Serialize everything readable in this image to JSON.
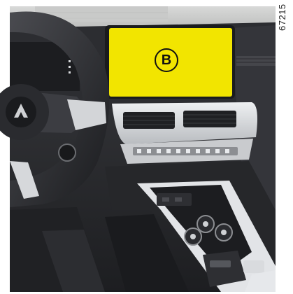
{
  "image": {
    "subject": "car-interior-dashboard",
    "screen_label": "B",
    "reference_code": "67215",
    "colors": {
      "screen_highlight": "#f2e500",
      "interior": "#2a2b2e",
      "trim": "#d9dbde",
      "background": "#ffffff"
    }
  }
}
